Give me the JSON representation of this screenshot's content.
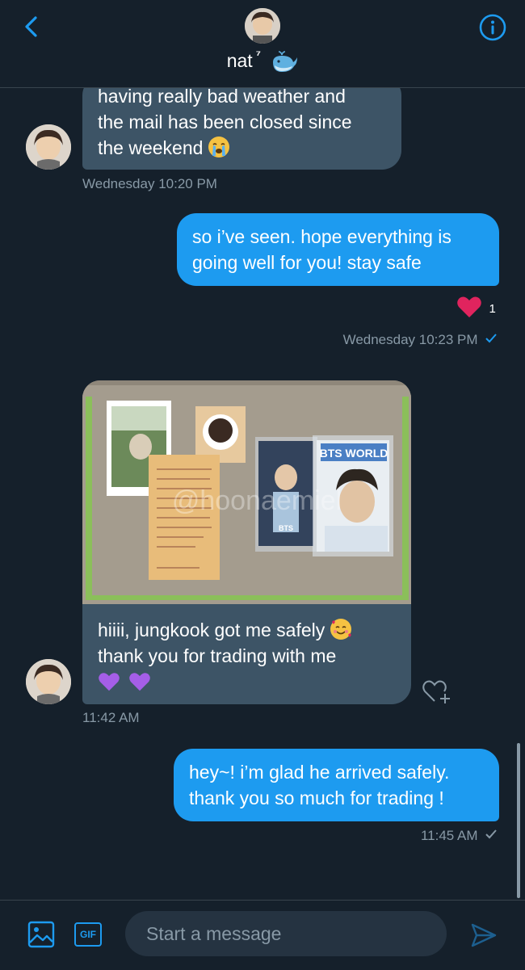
{
  "header": {
    "name": "nat",
    "name_suffix": "⁷",
    "avatar_icon": "profile-photo",
    "back_icon": "chevron-left-icon",
    "info_icon": "info-icon"
  },
  "messages": [
    {
      "direction": "received",
      "lines": [
        "having really bad weather and",
        "the mail has been closed since",
        "the weekend"
      ],
      "timestamp": "Wednesday 10:20 PM"
    },
    {
      "direction": "sent",
      "lines": [
        "so i’ve seen. hope everything is",
        "going well for you! stay safe"
      ],
      "reaction_count": "1",
      "timestamp": "Wednesday 10:23 PM"
    },
    {
      "direction": "received",
      "image_watermark": "@hoonaemiel",
      "image_card_text": "BTS WORLD",
      "lines": [
        "hiiii, jungkook got me safely",
        "thank you for trading with me"
      ],
      "timestamp": "11:42 AM"
    },
    {
      "direction": "sent",
      "lines": [
        "hey~! i’m glad he arrived safely.",
        "thank you so much for trading !"
      ],
      "timestamp": "11:45 AM"
    }
  ],
  "composer": {
    "placeholder": "Start a message",
    "gif_label": "GIF"
  },
  "colors": {
    "background": "#15202b",
    "accent": "#1d9bf0",
    "received_bubble": "#3d5466",
    "muted_text": "#8899a6",
    "heart": "#f91880"
  }
}
